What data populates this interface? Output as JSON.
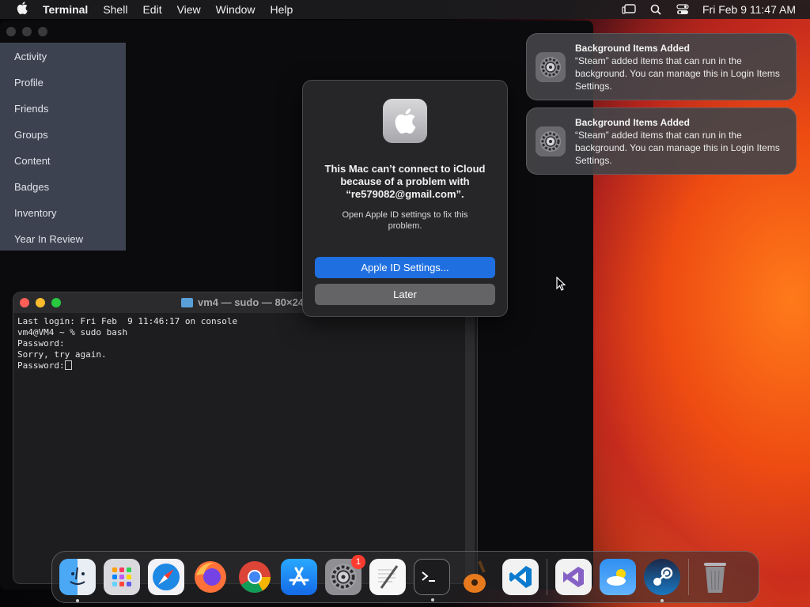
{
  "menubar": {
    "app_name": "Terminal",
    "items": [
      "Shell",
      "Edit",
      "View",
      "Window",
      "Help"
    ],
    "clock": "Fri Feb 9  11:47 AM"
  },
  "steam": {
    "menu": [
      "Activity",
      "Profile",
      "Friends",
      "Groups",
      "Content",
      "Badges",
      "Inventory",
      "Year In Review"
    ]
  },
  "terminal": {
    "title": "vm4 — sudo — 80×24",
    "lines": [
      "Last login: Fri Feb  9 11:46:17 on console",
      "vm4@VM4 ~ % sudo bash",
      "Password:",
      "Sorry, try again.",
      "Password:"
    ]
  },
  "dialog": {
    "heading": "This Mac can’t connect to iCloud because of a problem with “re579082@gmail.com”.",
    "body": "Open Apple ID settings to fix this problem.",
    "primary_button": "Apple ID Settings...",
    "secondary_button": "Later"
  },
  "notifications": [
    {
      "title": "Background Items Added",
      "message": "“Steam” added items that can run in the background. You can manage this in Login Items Settings."
    },
    {
      "title": "Background Items Added",
      "message": "“Steam” added items that can run in the background. You can manage this in Login Items Settings."
    }
  ],
  "dock": {
    "settings_badge": "1",
    "apps": [
      "finder-icon",
      "launchpad-icon",
      "safari-icon",
      "firefox-icon",
      "chrome-icon",
      "app-store-icon",
      "system-settings-icon",
      "textedit-icon",
      "terminal-icon",
      "garageband-icon",
      "vscode-icon",
      "visual-studio-icon",
      "weather-icon",
      "steam-icon",
      "trash-icon"
    ]
  },
  "colors": {
    "dialog_primary": "#1f6fe0",
    "badge": "#ff3b30",
    "steam_menu": "#3d4250"
  }
}
